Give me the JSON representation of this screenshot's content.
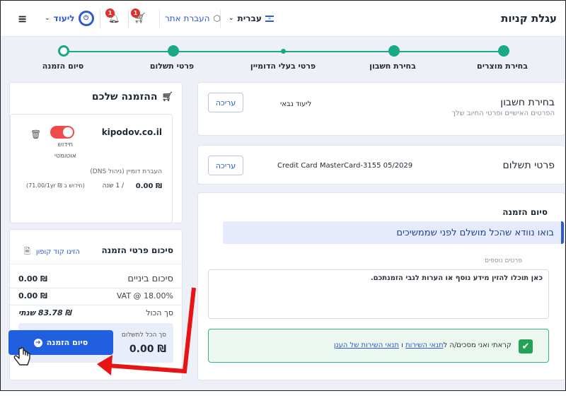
{
  "header": {
    "logo": "עגלת קניות",
    "language": "עברית",
    "transfer": "העברת אתר",
    "cart_count": "1",
    "notifications_count": "1",
    "login": "ליעוד"
  },
  "steps": [
    {
      "label": "בחירת מוצרים",
      "state": "done"
    },
    {
      "label": "בחירת חשבון",
      "state": "done"
    },
    {
      "label": "פרטי בעלי הדומיין",
      "state": "small"
    },
    {
      "label": "פרטי תשלום",
      "state": "done"
    },
    {
      "label": "סיום הזמנה",
      "state": "current"
    }
  ],
  "account": {
    "title": "בחירת חשבון",
    "subtitle": "הפרטים האישיים ופרטי החיוב שלך",
    "value": "ליעוד נבאי",
    "edit_label": "עריכה"
  },
  "payment": {
    "title": "פרטי תשלום",
    "value": "Credit Card MasterCard-3155 05/2029",
    "edit_label": "עריכה"
  },
  "finish": {
    "title": "סיום הזמנה",
    "info": "בואו נוודא שהכל מושלם לפני שממשיכים",
    "notes_label": "פרטים נוספים",
    "notes_placeholder": "כאן תוכלו להזין מידע נוסף או הערות לגבי הזמנתכם.",
    "terms_prefix": "קראתי ואני מסכים/ה ל",
    "terms_link1": "תנאי השירות",
    "terms_and": " ו ",
    "terms_link2": "תנאי השירות של הענן",
    "terms_checked": true
  },
  "order": {
    "title": "ההזמנה שלכם",
    "domain": "kipodov.co.il",
    "renew_label_1": "חידוש",
    "renew_label_2": "אוטומטי",
    "service": "העברת דומיין (ניהול DNS)",
    "price": "₪ 0.00",
    "period": "/ 1 שנה",
    "renewal": "(חידוש ב ₪ 71.00/1yr)"
  },
  "summary": {
    "title": "סיכום פרטי הזמנה",
    "coupon": "הזינו קוד קופון",
    "subtotal_label": "סיכום ביניים",
    "subtotal_value": "₪ 0.00",
    "vat_label": "VAT @ 18.00%",
    "vat_value": "₪ 0.00",
    "total_label": "סך הכול",
    "total_value": "₪ 83.78 שנתי",
    "pay_label": "סך הכל לתשלום",
    "pay_value": "₪ 0.00",
    "button_label": "סיום הזמנה"
  },
  "colors": {
    "accent": "#1f5fe0",
    "success": "#19a985",
    "danger": "#ef4b4b"
  }
}
